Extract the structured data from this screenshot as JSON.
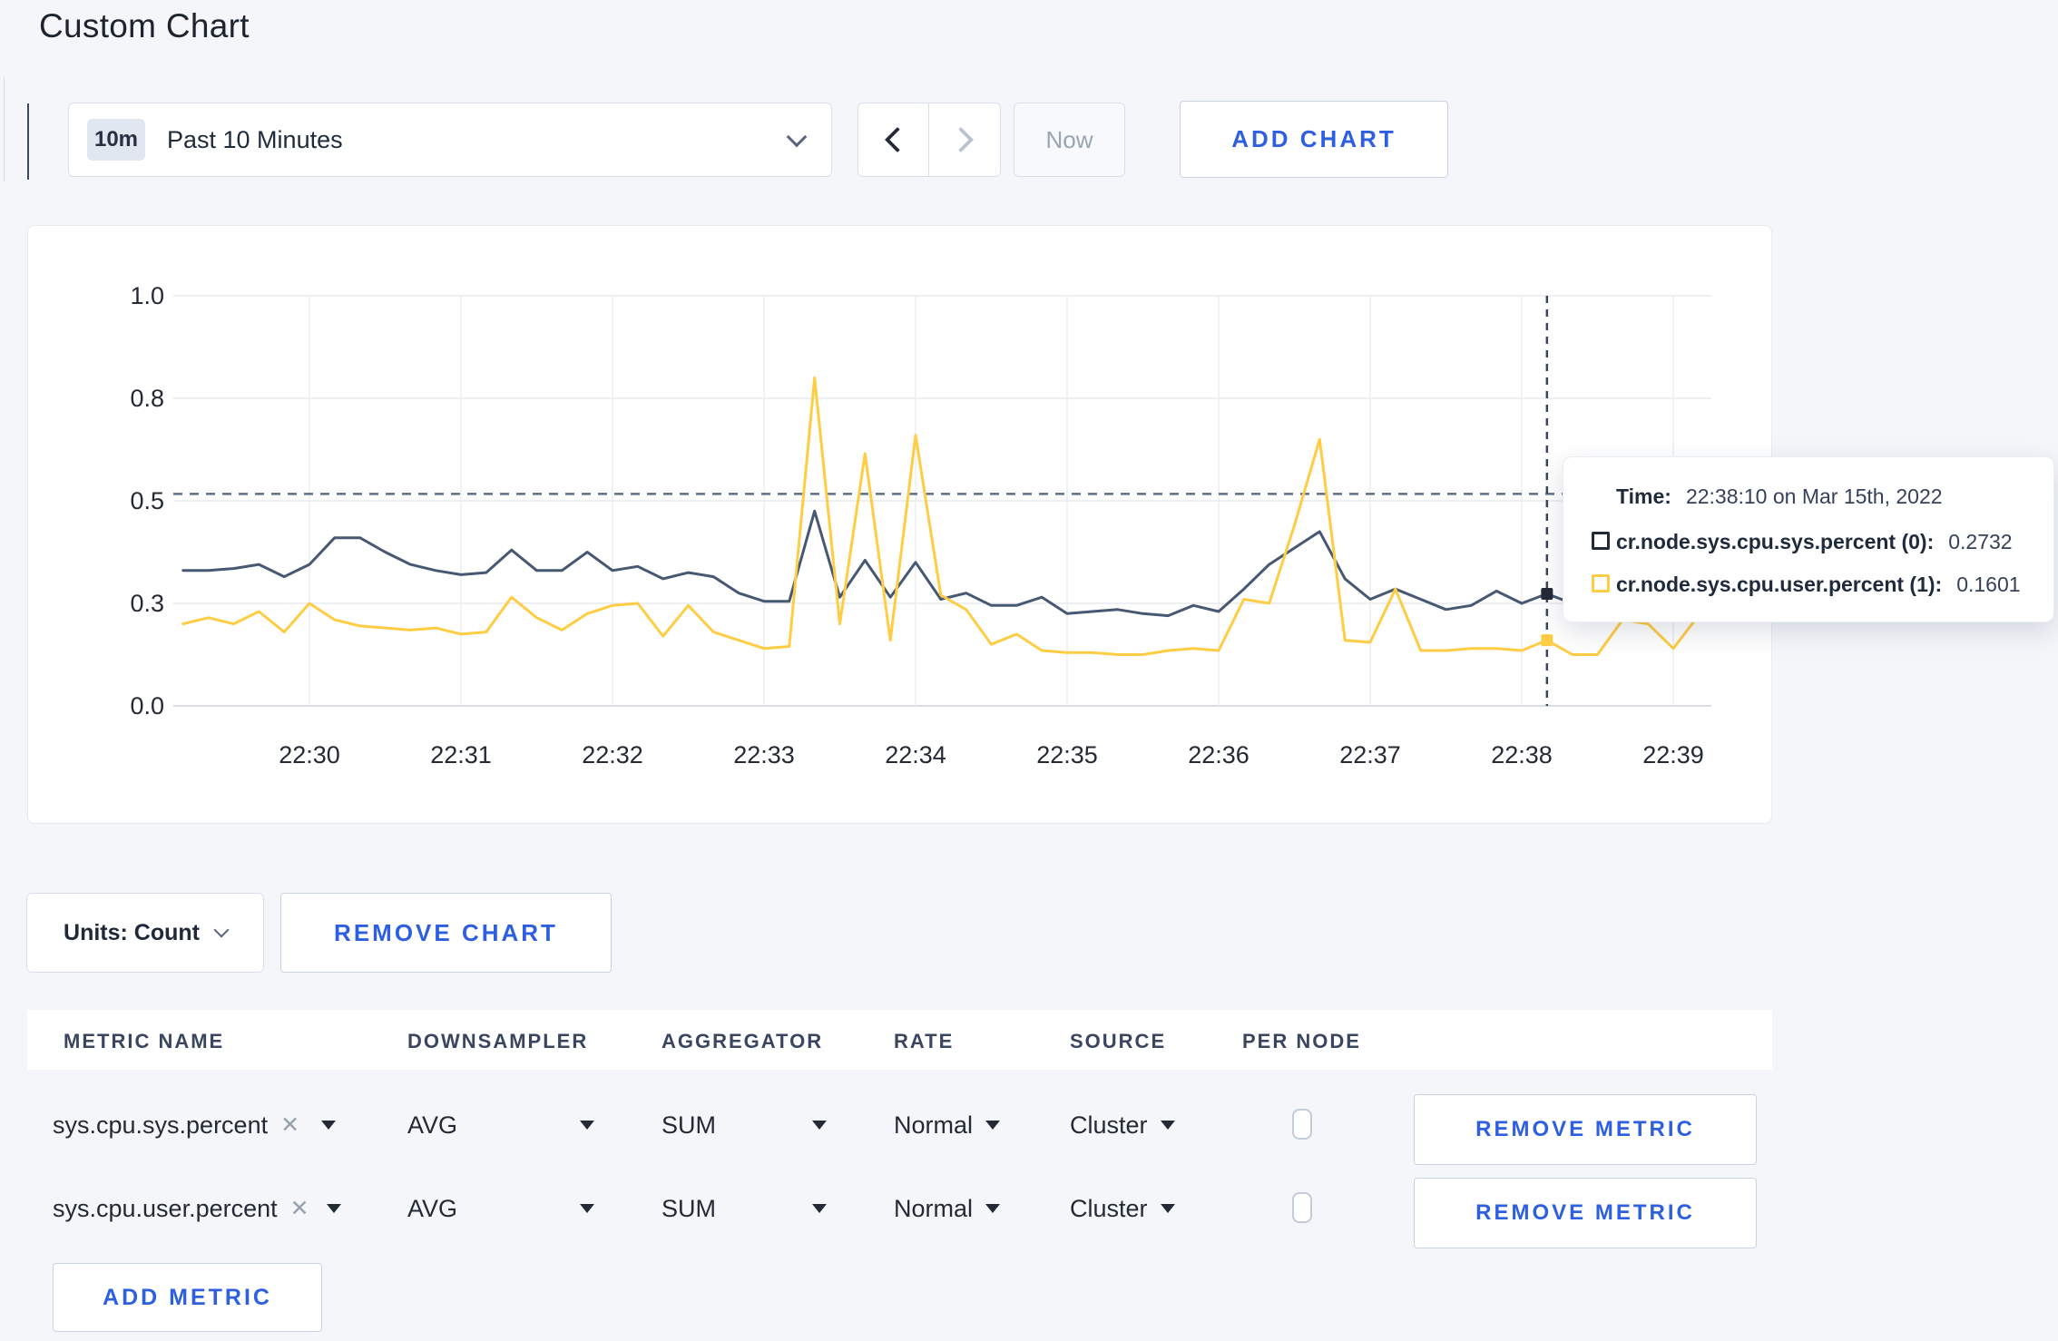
{
  "page": {
    "title": "Custom Chart"
  },
  "toolbar": {
    "range_badge": "10m",
    "range_label": "Past 10 Minutes",
    "now_label": "Now",
    "add_chart_label": "ADD CHART"
  },
  "chart_data": {
    "type": "line",
    "title": "",
    "xlabel": "",
    "ylabel": "",
    "ylim": [
      0,
      1
    ],
    "grid": true,
    "x_tick_labels": [
      "22:30",
      "22:31",
      "22:32",
      "22:33",
      "22:34",
      "22:35",
      "22:36",
      "22:37",
      "22:38",
      "22:39"
    ],
    "y_ticks": [
      {
        "value": 0,
        "label": "0.0"
      },
      {
        "value": 0.25,
        "label": "0.3"
      },
      {
        "value": 0.5,
        "label": "0.5"
      },
      {
        "value": 0.75,
        "label": "0.8"
      },
      {
        "value": 1,
        "label": "1.0"
      }
    ],
    "x_start_time": "22:29:10",
    "x_step_seconds": 10,
    "x_start_offset_seconds": -50,
    "guide_value": 0.517,
    "crosshair_time": "22:38:10",
    "crosshair_offset_seconds": 490,
    "hover_points": [
      {
        "series": 0,
        "value": 0.2732
      },
      {
        "series": 1,
        "value": 0.1601
      }
    ],
    "series": [
      {
        "name": "cr.node.sys.cpu.sys.percent",
        "color": "#475872",
        "values": [
          0.33,
          0.33,
          0.335,
          0.345,
          0.315,
          0.345,
          0.41,
          0.41,
          0.375,
          0.345,
          0.33,
          0.32,
          0.325,
          0.38,
          0.33,
          0.33,
          0.375,
          0.33,
          0.34,
          0.31,
          0.325,
          0.315,
          0.275,
          0.255,
          0.255,
          0.475,
          0.265,
          0.355,
          0.265,
          0.35,
          0.26,
          0.275,
          0.245,
          0.245,
          0.265,
          0.225,
          0.23,
          0.235,
          0.225,
          0.22,
          0.245,
          0.23,
          0.285,
          0.345,
          0.385,
          0.425,
          0.31,
          0.26,
          0.285,
          0.26,
          0.235,
          0.245,
          0.28,
          0.25,
          0.2732,
          0.25,
          0.26,
          0.27,
          0.29,
          0.3,
          0.31
        ]
      },
      {
        "name": "cr.node.sys.cpu.user.percent",
        "color": "#FFCD44",
        "values": [
          0.2,
          0.215,
          0.2,
          0.23,
          0.18,
          0.25,
          0.21,
          0.195,
          0.19,
          0.185,
          0.19,
          0.175,
          0.18,
          0.265,
          0.215,
          0.185,
          0.225,
          0.245,
          0.25,
          0.17,
          0.245,
          0.18,
          0.16,
          0.14,
          0.145,
          0.8,
          0.2,
          0.615,
          0.16,
          0.66,
          0.27,
          0.235,
          0.15,
          0.175,
          0.135,
          0.13,
          0.13,
          0.125,
          0.125,
          0.135,
          0.14,
          0.135,
          0.26,
          0.25,
          0.44,
          0.65,
          0.16,
          0.155,
          0.285,
          0.135,
          0.135,
          0.14,
          0.14,
          0.135,
          0.1601,
          0.125,
          0.125,
          0.21,
          0.2,
          0.14,
          0.22
        ]
      }
    ]
  },
  "tooltip": {
    "time_label": "Time:",
    "time_value": "22:38:10 on Mar 15th, 2022",
    "rows": [
      {
        "label": "cr.node.sys.cpu.sys.percent (0):",
        "value": "0.2732",
        "swatch": "#242A35"
      },
      {
        "label": "cr.node.sys.cpu.user.percent (1):",
        "value": "0.1601",
        "swatch": "#FFCD44"
      }
    ]
  },
  "chart_footer": {
    "units_label": "Units: Count",
    "remove_chart_label": "REMOVE CHART"
  },
  "metrics_table": {
    "headers": [
      "METRIC NAME",
      "DOWNSAMPLER",
      "AGGREGATOR",
      "RATE",
      "SOURCE",
      "PER NODE"
    ],
    "rows": [
      {
        "metric": "sys.cpu.sys.percent",
        "clear": "✕",
        "downsampler": "AVG",
        "aggregator": "SUM",
        "rate": "Normal",
        "source": "Cluster",
        "per_node_checked": false,
        "remove_label": "REMOVE METRIC"
      },
      {
        "metric": "sys.cpu.user.percent",
        "clear": "✕",
        "downsampler": "AVG",
        "aggregator": "SUM",
        "rate": "Normal",
        "source": "Cluster",
        "per_node_checked": false,
        "remove_label": "REMOVE METRIC"
      }
    ],
    "add_metric_label": "ADD METRIC"
  },
  "colors": {
    "accent_blue": "#2D5FE0",
    "series_blue": "#475872",
    "series_yellow": "#FFCD44",
    "page_bg": "#F4F6FA"
  }
}
